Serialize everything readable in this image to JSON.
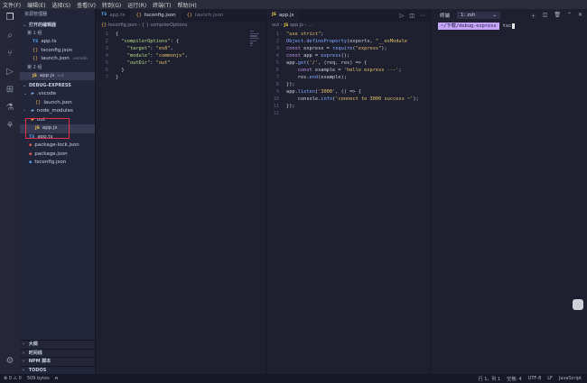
{
  "menu": [
    "文件(F)",
    "编辑(E)",
    "选择(S)",
    "查看(V)",
    "转到(G)",
    "运行(R)",
    "终端(T)",
    "帮助(H)"
  ],
  "activity_icons": [
    "files-icon",
    "search-icon",
    "source-control-icon",
    "run-debug-icon",
    "extensions-icon",
    "testing-icon",
    "remote-icon"
  ],
  "sidebar": {
    "title": "资源管理器",
    "open_editors": {
      "label": "打开的编辑器",
      "group1": "第 1 组",
      "group1_items": [
        {
          "name": "app.ts",
          "type": "ts"
        },
        {
          "name": "tsconfig.json",
          "type": "json"
        },
        {
          "name": "launch.json",
          "type": "json",
          "sub": ".vscode"
        }
      ],
      "group2": "第 2 组",
      "group2_items": [
        {
          "name": "app.js",
          "type": "js",
          "sub": "out"
        }
      ]
    },
    "project": {
      "label": "DEBUG-EXPRESS",
      "vscode_folder": ".vscode",
      "launch_json": "launch.json",
      "node_modules": "node_modules",
      "out_folder": "out",
      "out_app_js": "app.js",
      "app_ts": "app.ts",
      "package_lock": "package-lock.json",
      "package_json": "package.json",
      "tsconfig": "tsconfig.json"
    },
    "bottom_sections": [
      "大纲",
      "时间线",
      "NPM 脚本",
      "TODOS"
    ]
  },
  "editor1": {
    "tabs": [
      {
        "label": "app.ts",
        "type": "ts",
        "active": false
      },
      {
        "label": "tsconfig.json",
        "type": "json",
        "active": true
      },
      {
        "label": "launch.json",
        "type": "json",
        "active": false
      }
    ],
    "breadcrumb": [
      "tsconfig.json",
      "{ } compilerOptions"
    ],
    "lines": [
      [
        [
          "pl",
          "{"
        ]
      ],
      [
        [
          "pl",
          "  "
        ],
        [
          "key",
          "\"compilerOptions\""
        ],
        [
          "pl",
          ": {"
        ]
      ],
      [
        [
          "pl",
          "    "
        ],
        [
          "key",
          "\"target\""
        ],
        [
          "pl",
          ": "
        ],
        [
          "str",
          "\"es6\""
        ],
        [
          "pl",
          ","
        ]
      ],
      [
        [
          "pl",
          "    "
        ],
        [
          "key",
          "\"module\""
        ],
        [
          "pl",
          ": "
        ],
        [
          "str",
          "\"commonjs\""
        ],
        [
          "pl",
          ","
        ]
      ],
      [
        [
          "pl",
          "    "
        ],
        [
          "key",
          "\"outDir\""
        ],
        [
          "pl",
          ": "
        ],
        [
          "str",
          "\"out\""
        ]
      ],
      [
        [
          "pl",
          "  }"
        ]
      ],
      [
        [
          "pl",
          "}"
        ]
      ]
    ]
  },
  "editor2": {
    "tabs": [
      {
        "label": "app.js",
        "type": "js",
        "active": true
      }
    ],
    "breadcrumb": [
      "out",
      "app.js",
      "..."
    ],
    "lines": [
      [
        [
          "str",
          "\"use strict\""
        ],
        [
          "pl",
          ";"
        ]
      ],
      [
        [
          "fn",
          "Object"
        ],
        [
          "pl",
          "."
        ],
        [
          "fn",
          "defineProperty"
        ],
        [
          "pl",
          "(exports, "
        ],
        [
          "str",
          "\"__esModule"
        ]
      ],
      [
        [
          "kw",
          "const"
        ],
        [
          "pl",
          " express = "
        ],
        [
          "fn",
          "require"
        ],
        [
          "pl",
          "("
        ],
        [
          "str",
          "\"express\""
        ],
        [
          "pl",
          ");"
        ]
      ],
      [
        [
          "kw",
          "const"
        ],
        [
          "pl",
          " app = "
        ],
        [
          "fn",
          "express"
        ],
        [
          "pl",
          "();"
        ]
      ],
      [
        [
          "pl",
          "app."
        ],
        [
          "fn",
          "get"
        ],
        [
          "pl",
          "("
        ],
        [
          "str",
          "'/'"
        ],
        [
          "pl",
          ", (req, res) => {"
        ]
      ],
      [
        [
          "pl",
          "    "
        ],
        [
          "kw",
          "const"
        ],
        [
          "pl",
          " example = "
        ],
        [
          "str",
          "'hello express ---'"
        ],
        [
          "pl",
          ";"
        ]
      ],
      [
        [
          "pl",
          "    res."
        ],
        [
          "fn",
          "end"
        ],
        [
          "pl",
          "(example);"
        ]
      ],
      [
        [
          "pl",
          "});"
        ]
      ],
      [
        [
          "pl",
          "app."
        ],
        [
          "fn",
          "listen"
        ],
        [
          "pl",
          "("
        ],
        [
          "str",
          "'3000'"
        ],
        [
          "pl",
          ", () => {"
        ]
      ],
      [
        [
          "pl",
          "    console."
        ],
        [
          "fn",
          "info"
        ],
        [
          "pl",
          "("
        ],
        [
          "str",
          "'connect to 3000 success ~'"
        ],
        [
          "pl",
          ");"
        ]
      ],
      [
        [
          "pl",
          "});"
        ]
      ],
      []
    ]
  },
  "terminal": {
    "label": "终端",
    "shell": "1: zsh",
    "prompt_path": "~/下载/debug-express",
    "command": "tsc"
  },
  "status": {
    "left": [
      "⊗ 0 ⚠ 0",
      "509 bytes"
    ],
    "right": [
      "行 1，列 1",
      "空格: 4",
      "UTF-8",
      "LF",
      "JavaScript"
    ]
  }
}
